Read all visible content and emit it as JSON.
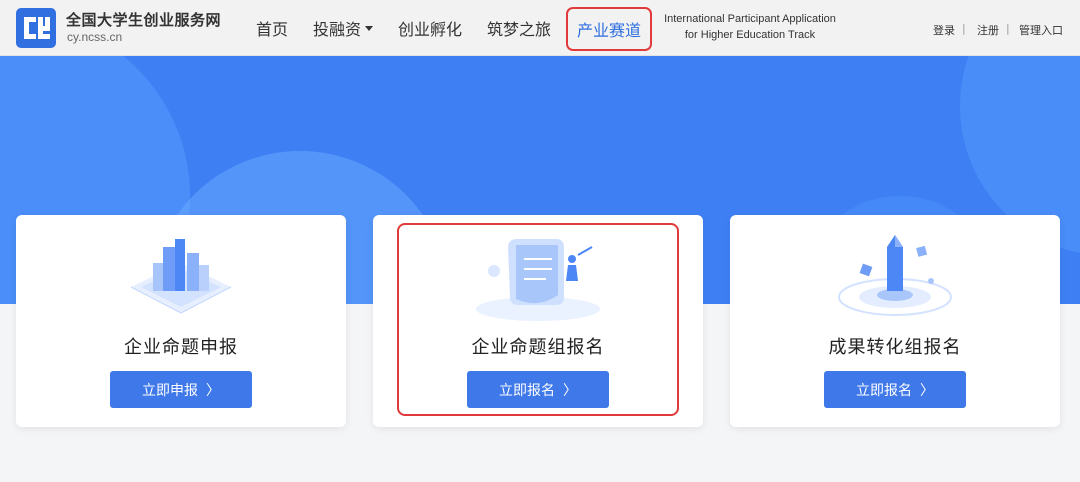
{
  "header": {
    "site_name": "全国大学生创业服务网",
    "site_url": "cy.ncss.cn",
    "nav": {
      "home": "首页",
      "invest": "投融资",
      "incubate": "创业孵化",
      "journey": "筑梦之旅",
      "track": "产业赛道"
    },
    "intl_line1": "International Participant Application",
    "intl_line2": "for Higher Education Track",
    "login": "登录",
    "register": "注册",
    "admin": "管理入口",
    "separator": "|"
  },
  "cards": [
    {
      "title": "企业命题申报",
      "button": "立即申报",
      "chevron": "〉",
      "icon": "city-buildings-icon"
    },
    {
      "title": "企业命题组报名",
      "button": "立即报名",
      "chevron": "〉",
      "icon": "scroll-climber-icon"
    },
    {
      "title": "成果转化组报名",
      "button": "立即报名",
      "chevron": "〉",
      "icon": "crystal-tower-icon"
    }
  ],
  "colors": {
    "brand_blue": "#3e80f4",
    "button_blue": "#3f78e8",
    "highlight_red": "#e03a3a"
  }
}
